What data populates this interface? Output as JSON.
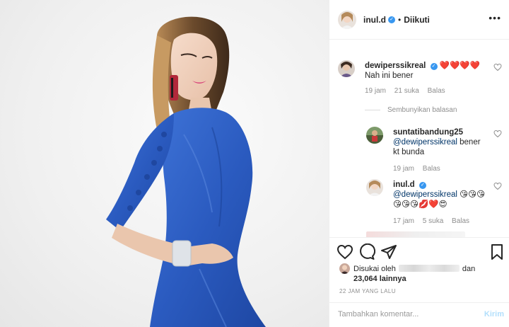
{
  "post": {
    "photo_alt": "Woman in blue dress posing",
    "header": {
      "username": "inul.d",
      "separator": "•",
      "follow_state": "Diikuti",
      "more_glyph": "•••"
    }
  },
  "comments": [
    {
      "username": "dewiperssikreal",
      "verified": true,
      "text_hearts": "❤️❤️❤️❤️",
      "text": "Nah ini bener",
      "time": "19 jam",
      "likes": "21 suka",
      "reply": "Balas"
    }
  ],
  "hide_replies_label": "Sembunyikan balasan",
  "replies": [
    {
      "username": "suntatibandung25",
      "mention": "@dewiperssikreal",
      "text": "bener kt bunda",
      "time": "19 jam",
      "reply": "Balas"
    },
    {
      "username": "inul.d",
      "verified": true,
      "mention": "@dewiperssikreal",
      "emoji_line1": "😘😘😘",
      "emoji_line2": "😘😘😘💋❤️😍",
      "time": "17 jam",
      "likes": "5 suka",
      "reply": "Balas"
    }
  ],
  "likes_section": {
    "liked_by_prefix": "Disukai oleh",
    "and_label": "dan",
    "others": "23,064 lainnya"
  },
  "timestamp": "22 JAM YANG LALU",
  "add_comment": {
    "placeholder": "Tambahkan komentar...",
    "submit": "Kirim"
  },
  "icons": [
    "heart-icon",
    "comment-icon",
    "share-icon",
    "bookmark-icon",
    "verified-badge-icon",
    "more-options-icon"
  ],
  "colors": {
    "verified": "#3897f0",
    "dress": "#2f5fc4",
    "submit_disabled": "#b2dffc",
    "secondary_text": "#8e8e8e"
  }
}
